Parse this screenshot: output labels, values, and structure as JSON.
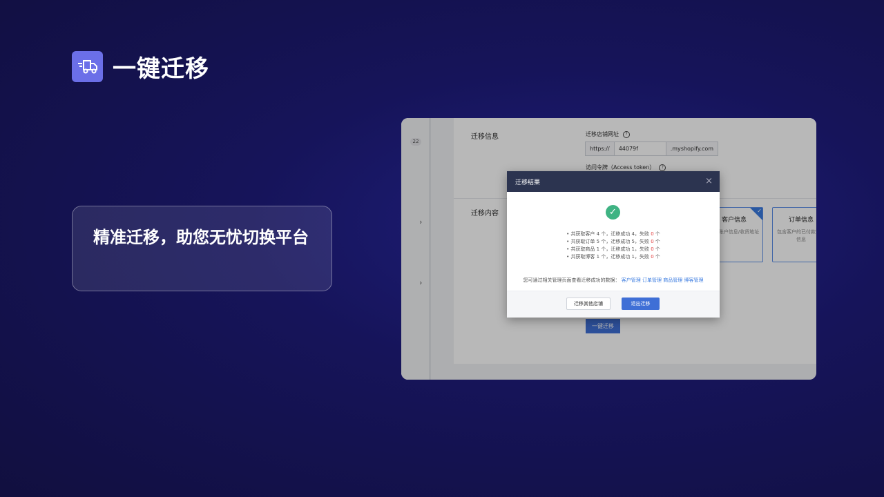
{
  "header": {
    "title": "一键迁移",
    "icon": "truck-migrate-icon"
  },
  "feature": {
    "text": "精准迁移，助您无忧切换平台"
  },
  "app": {
    "sidebar": {
      "badge": "22"
    },
    "section_info": "迁移信息",
    "store_url_label": "迁移店铺网址",
    "url_prefix": "https://",
    "url_value": "44079f",
    "url_suffix": ".myshopify.com",
    "token_label": "访问令牌（Access token）",
    "section_content": "迁移内容",
    "cards": [
      {
        "title": "客户信息",
        "desc": "户的账户信息/收货地址",
        "selected": true
      },
      {
        "title": "订单信息",
        "desc": "包含客户的已付款订单信息",
        "selected": false
      }
    ],
    "one_click_button": "一键迁移"
  },
  "modal": {
    "title": "迁移结果",
    "results": [
      {
        "text": "共获取客户 4 个，迁移成功 4，失败 ",
        "fail": "0",
        "unit": " 个"
      },
      {
        "text": "共获取订单 5 个，迁移成功 5，失败 ",
        "fail": "0",
        "unit": " 个"
      },
      {
        "text": "共获取商品 1 个，迁移成功 1，失败 ",
        "fail": "0",
        "unit": " 个"
      },
      {
        "text": "共获取博客 1 个，迁移成功 1，失败 ",
        "fail": "0",
        "unit": " 个"
      }
    ],
    "links_prefix": "您可通过相关管理页面查看迁移成功的数据：",
    "links": [
      "客户管理",
      "订单管理",
      "商品管理",
      "博客管理"
    ],
    "btn_other": "迁移其他店铺",
    "btn_exit": "退出迁移"
  },
  "colors": {
    "accent": "#3f6fd6",
    "success": "#3fb383",
    "fail": "#e23c3c",
    "bg": "#16145a"
  }
}
